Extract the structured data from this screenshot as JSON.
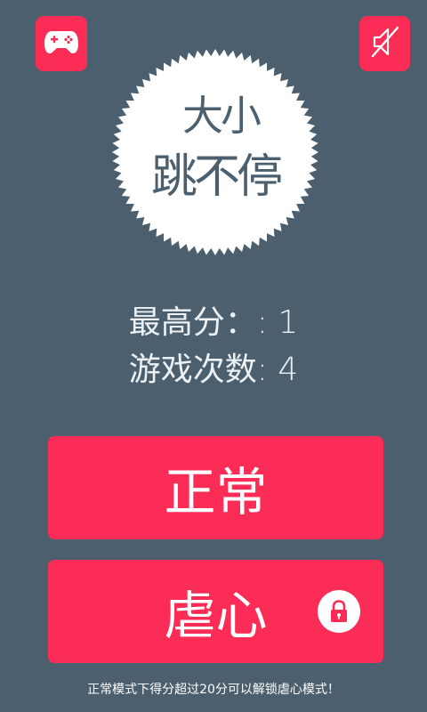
{
  "header": {
    "left_button_icon": "gamepad-icon",
    "right_button_icon": "sound-muted-icon"
  },
  "logo": {
    "line1": "大小",
    "line2": "跳不停"
  },
  "stats": {
    "best_score_text": "最高分：: 1",
    "games_played_text": "游戏次数: 4"
  },
  "modes": {
    "normal_label": "正常",
    "hard_label": "虐心",
    "hard_locked_icon": "lock-icon"
  },
  "footer": {
    "hint": "正常模式下得分超过20分可以解锁虐心模式！"
  },
  "colors": {
    "background": "#4b5f6f",
    "accent": "#fb2c55",
    "logo_badge": "#ffffff"
  }
}
